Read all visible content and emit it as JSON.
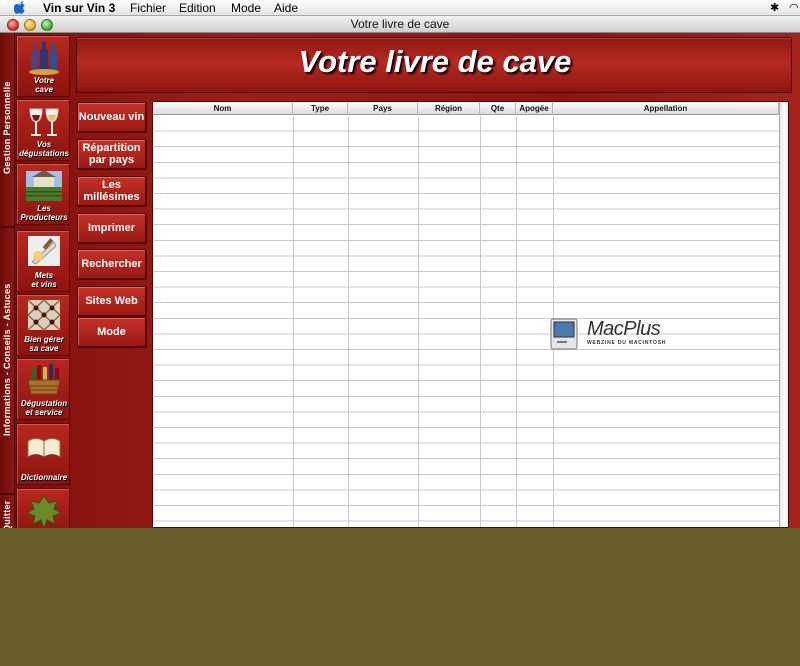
{
  "menubar": {
    "app_name": "Vin sur Vin 3",
    "items": [
      "Fichier",
      "Edition",
      "Mode",
      "Aide"
    ]
  },
  "window": {
    "title": "Votre livre de cave"
  },
  "banner": {
    "title": "Votre livre de cave"
  },
  "strip": {
    "section1": "Gestion Personnelle",
    "section2": "Informations - Conseils - Astuces",
    "section3": "Quitter"
  },
  "icons": [
    {
      "label": "Votre\ncave"
    },
    {
      "label": "Vos\ndégustations"
    },
    {
      "label": "Les\nProducteurs"
    },
    {
      "label": "Mets\net vins"
    },
    {
      "label": "Bien gérer\nsa cave"
    },
    {
      "label": "Dégustation\net service"
    },
    {
      "label": "Dictionnaire"
    }
  ],
  "actions": [
    "Nouveau vin",
    "Répartition\npar pays",
    "Les\nmillésimes",
    "Imprimer",
    "Rechercher",
    "Sites Web",
    "Mode"
  ],
  "table": {
    "columns": [
      "Nom",
      "Type",
      "Pays",
      "Région",
      "Qte",
      "Apogée",
      "Appellation"
    ]
  },
  "watermark": {
    "brand": "MacPlus",
    "tagline": "WEBZINE DU MACINTOSH"
  },
  "colors": {
    "desktop": "#655c28",
    "chrome_red": "#9f1d17"
  }
}
